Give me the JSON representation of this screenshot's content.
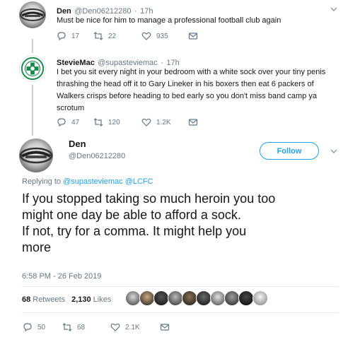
{
  "reply1": {
    "author": "Den",
    "handle": "@Den06212280",
    "time": "17h",
    "text": "Must be nice for him to manage a professional football club again",
    "replies": "17",
    "retweets": "22",
    "likes": "935"
  },
  "reply2": {
    "author": "StevieMac",
    "handle": "@supasteviemac",
    "time": "17h",
    "text_lines": [
      "I bet you sit every night in your bedroom with a white sock over your tiny penis",
      "thrashing the head off it to Gary Lineker in his boxers then eat 6 packers of",
      "Walkers crisps before heading to bed early so you don't miss band camp ya",
      "scrotum"
    ],
    "replies": "47",
    "retweets": "120",
    "likes": "1.2K"
  },
  "main": {
    "author": "Den",
    "handle": "@Den06212280",
    "follow_label": "Follow",
    "replying_prefix": "Replying to",
    "replying_to": "@supasteviemac @LCFC",
    "text_lines": [
      "If you stopped taking so much heroin you too",
      "might one day be able to afford a sock.",
      "If not, try for a comma. It might help you",
      "more"
    ],
    "timestamp": "6:58 PM - 26 Feb 2019",
    "retweets_count": "68",
    "retweets_label": "Retweets",
    "likes_count": "2,130",
    "likes_label": "Likes",
    "replies": "50",
    "retweets": "68",
    "likes": "2.1K"
  },
  "colors": {
    "accent": "#1da1f2",
    "muted": "#657786",
    "text": "#14171a",
    "thread_line": "#c4cfd6"
  },
  "icons": [
    "reply-icon",
    "retweet-icon",
    "like-icon",
    "message-icon",
    "chevron-down-icon"
  ]
}
